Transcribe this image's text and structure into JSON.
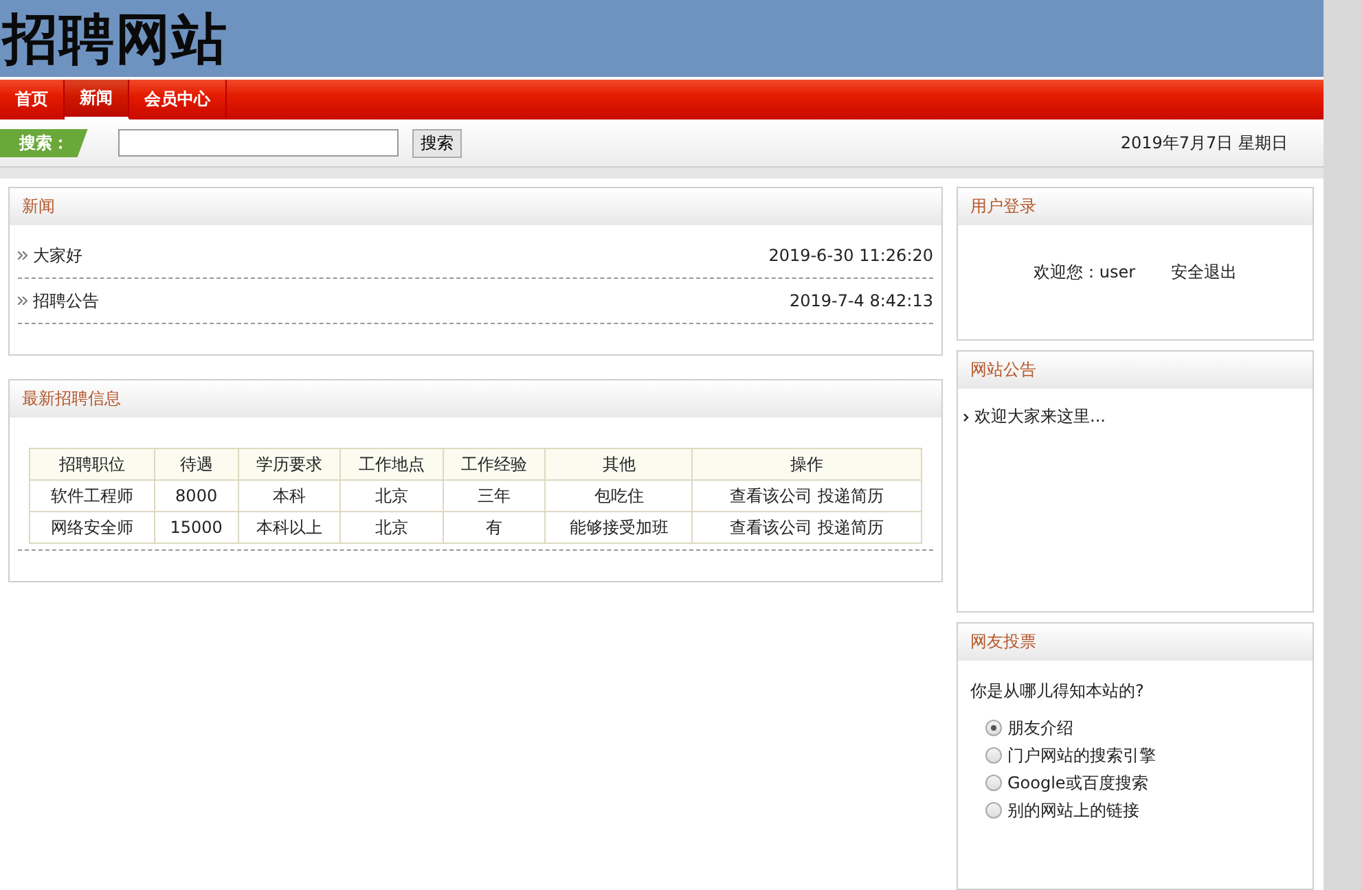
{
  "site_title": "招聘网站",
  "nav": [
    {
      "label": "首页",
      "selected": false
    },
    {
      "label": "新闻",
      "selected": true
    },
    {
      "label": "会员中心",
      "selected": false
    }
  ],
  "search": {
    "label": "搜索：",
    "button": "搜索"
  },
  "date": "2019年7月7日 星期日",
  "news": {
    "title": "新闻",
    "items": [
      {
        "title": "大家好",
        "time": "2019-6-30 11:26:20"
      },
      {
        "title": "招聘公告",
        "time": "2019-7-4 8:42:13"
      }
    ]
  },
  "jobs": {
    "title": "最新招聘信息",
    "columns": [
      "招聘职位",
      "待遇",
      "学历要求",
      "工作地点",
      "工作经验",
      "其他",
      "操作"
    ],
    "rows": [
      {
        "cells": [
          "软件工程师",
          "8000",
          "本科",
          "北京",
          "三年",
          "包吃住"
        ],
        "actions": [
          "查看该公司",
          "投递简历"
        ]
      },
      {
        "cells": [
          "网络安全师",
          "15000",
          "本科以上",
          "北京",
          "有",
          "能够接受加班"
        ],
        "actions": [
          "查看该公司",
          "投递简历"
        ]
      }
    ]
  },
  "login": {
    "title": "用户登录",
    "welcome": "欢迎您：user",
    "logout": "安全退出"
  },
  "notice": {
    "title": "网站公告",
    "items": [
      "欢迎大家来这里..."
    ]
  },
  "poll": {
    "title": "网友投票",
    "question": "你是从哪儿得知本站的?",
    "options": [
      {
        "label": "朋友介绍",
        "selected": true
      },
      {
        "label": "门户网站的搜索引擎",
        "selected": false
      },
      {
        "label": "Google或百度搜索",
        "selected": false
      },
      {
        "label": "别的网站上的链接",
        "selected": false
      }
    ]
  }
}
